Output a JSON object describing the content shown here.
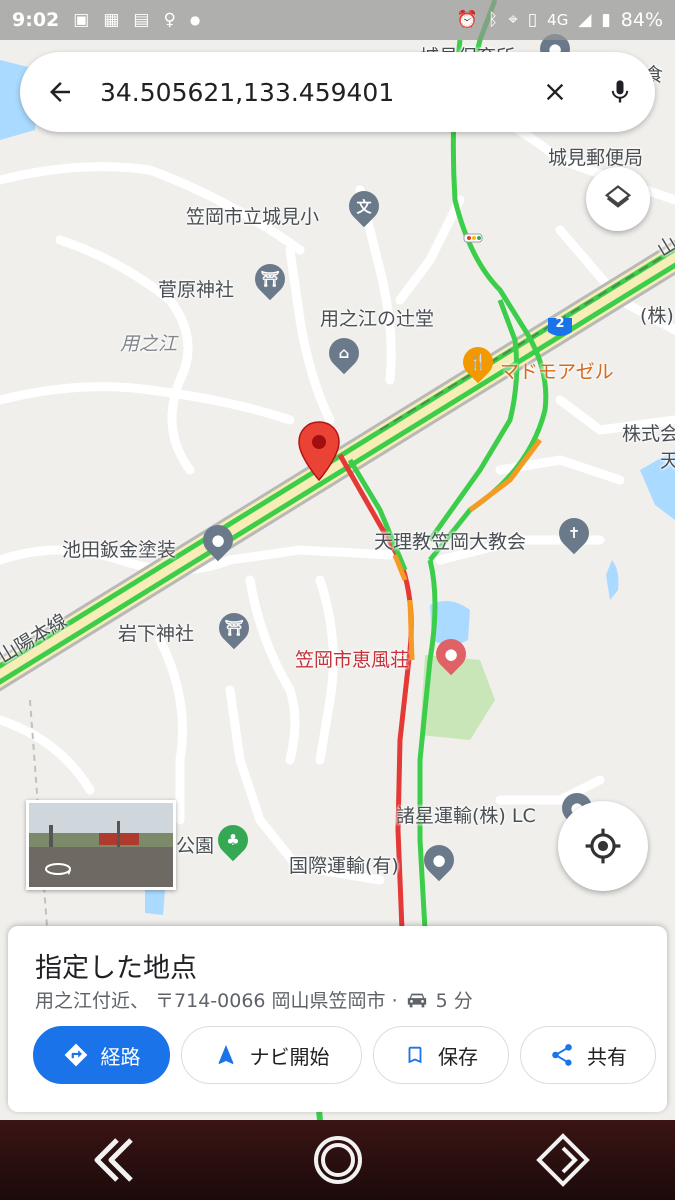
{
  "status_bar": {
    "time": "9:02",
    "network": "4G",
    "battery": "84%"
  },
  "search": {
    "query": "34.505621,133.459401"
  },
  "map_labels": {
    "shiromi_nursery": "城見保育所",
    "shiromi_post": "城見郵便局",
    "shiromi_school": "笠岡市立城見小",
    "sugawara_shrine": "菅原神社",
    "mochinoe": "用之江",
    "mochinoe_tsujido": "用之江の辻堂",
    "madomoazeru": "マドモアゼル",
    "kabu": "(株)",
    "kabushiki": "株式会",
    "ten": "天",
    "ikeda": "池田鈑金塗装",
    "tenrikyo": "天理教笠岡大教会",
    "sanyo_line": "山陽本線",
    "iwashita_shrine": "岩下神社",
    "keifuso": "笠岡市恵風荘",
    "shosei": "諸星運輸(株) LC",
    "koen": "公園",
    "kokusai": "国際運輸(有)",
    "route_2": "2",
    "edge_yama": "山",
    "edge_ho": "浦食"
  },
  "place_sheet": {
    "title": "指定した地点",
    "address": "用之江付近、 〒714-0066 岡山県笠岡市 ·",
    "drive_time": "5 分"
  },
  "actions": {
    "directions": "経路",
    "navigate": "ナビ開始",
    "save": "保存",
    "share": "共有"
  },
  "colors": {
    "primary_blue": "#1a73e8",
    "marker_red": "#ea4335",
    "traffic_green": "#3ccd4a",
    "traffic_orange": "#f59a23",
    "traffic_red": "#e53935",
    "highway_yellow": "#f9e79f"
  }
}
